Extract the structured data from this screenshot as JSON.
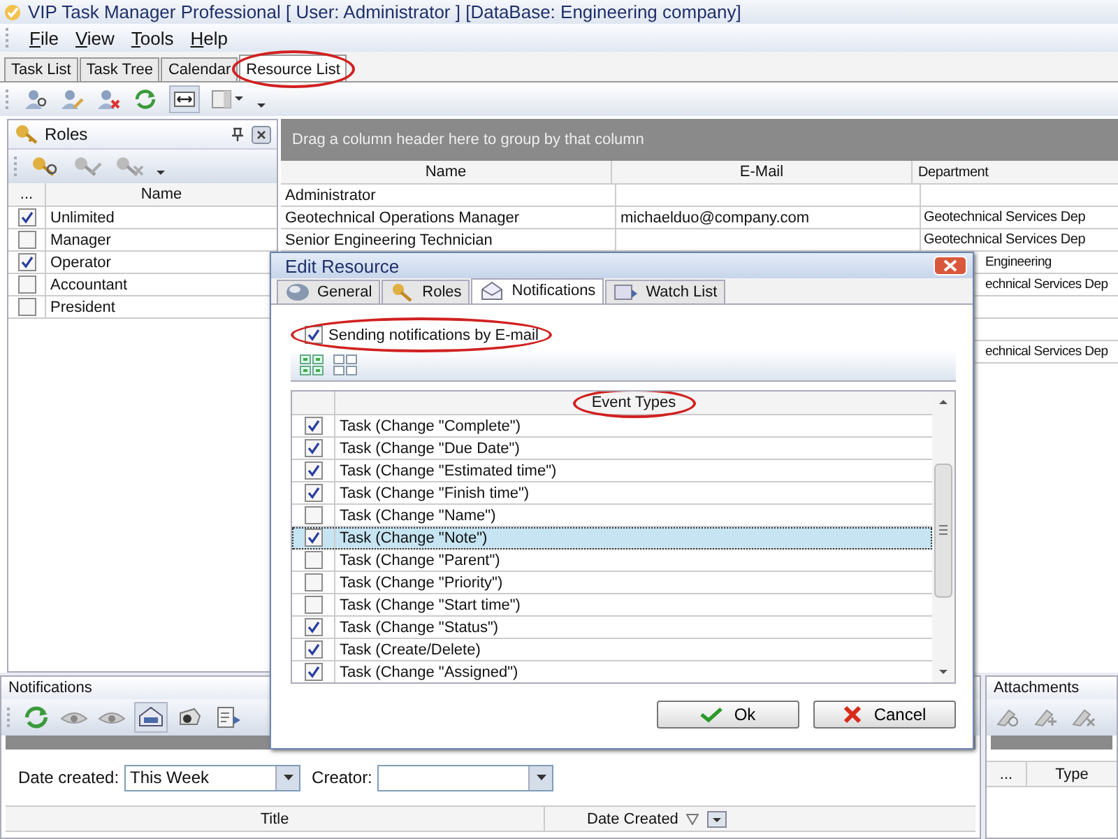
{
  "window": {
    "title": "VIP Task Manager Professional [ User: Administrator ] [DataBase: Engineering company]"
  },
  "menu": [
    {
      "label": "File"
    },
    {
      "label": "View"
    },
    {
      "label": "Tools"
    },
    {
      "label": "Help"
    }
  ],
  "tabs": [
    {
      "label": "Task List",
      "selected": false
    },
    {
      "label": "Task Tree",
      "selected": false
    },
    {
      "label": "Calendar",
      "selected": false
    },
    {
      "label": "Resource List",
      "selected": true
    }
  ],
  "roles_panel": {
    "title": "Roles",
    "columns": [
      "...",
      "Name"
    ],
    "rows": [
      {
        "name": "Unlimited",
        "checked": true
      },
      {
        "name": "Manager",
        "checked": false
      },
      {
        "name": "Operator",
        "checked": true
      },
      {
        "name": "Accountant",
        "checked": false
      },
      {
        "name": "President",
        "checked": false
      }
    ]
  },
  "resources": {
    "group_hint": "Drag a column header here to group by that column",
    "columns": [
      "Name",
      "E-Mail",
      "Department"
    ],
    "rows": [
      {
        "name": "Administrator"
      },
      {
        "name": "Geotechnical Operations Manager",
        "email": "michaelduo@company.com",
        "department": "Geotechnical Services Dep"
      },
      {
        "name": "Senior Engineering Technician",
        "department": "Geotechnical Services Dep"
      },
      {
        "department": "Engineering"
      },
      {
        "department": "echnical Services Dep"
      },
      {},
      {},
      {
        "department": "echnical Services Dep"
      }
    ]
  },
  "dialog": {
    "title": "Edit Resource",
    "tabs": [
      {
        "label": "General",
        "selected": false
      },
      {
        "label": "Roles",
        "selected": false
      },
      {
        "label": "Notifications",
        "selected": true
      },
      {
        "label": "Watch List",
        "selected": false
      }
    ],
    "send_by_email": {
      "label": "Sending notifications by E-mail",
      "checked": true
    },
    "column": "Event Types",
    "events": [
      {
        "label": "Task (Change \"Complete\")",
        "checked": true,
        "selected": false
      },
      {
        "label": "Task (Change \"Due Date\")",
        "checked": true,
        "selected": false
      },
      {
        "label": "Task (Change \"Estimated time\")",
        "checked": true,
        "selected": false
      },
      {
        "label": "Task (Change \"Finish time\")",
        "checked": true,
        "selected": false
      },
      {
        "label": "Task (Change \"Name\")",
        "checked": false,
        "selected": false
      },
      {
        "label": "Task (Change \"Note\")",
        "checked": true,
        "selected": true
      },
      {
        "label": "Task (Change \"Parent\")",
        "checked": false,
        "selected": false
      },
      {
        "label": "Task (Change \"Priority\")",
        "checked": false,
        "selected": false
      },
      {
        "label": "Task (Change \"Start time\")",
        "checked": false,
        "selected": false
      },
      {
        "label": "Task (Change \"Status\")",
        "checked": true,
        "selected": false
      },
      {
        "label": "Task (Create/Delete)",
        "checked": true,
        "selected": false
      },
      {
        "label": "Task (Change \"Assigned\")",
        "checked": true,
        "selected": false
      }
    ],
    "buttons": [
      {
        "label": "Ok",
        "kind": "ok"
      },
      {
        "label": "Cancel",
        "kind": "cancel"
      }
    ]
  },
  "notifications_panel": {
    "title": "Notifications",
    "date_created": {
      "label": "Date created:",
      "value": "This Week"
    },
    "creator": {
      "label": "Creator:"
    },
    "columns": [
      "Title",
      "Date Created"
    ]
  },
  "attachments_panel": {
    "title": "Attachments",
    "columns": [
      "...",
      "Type"
    ]
  }
}
